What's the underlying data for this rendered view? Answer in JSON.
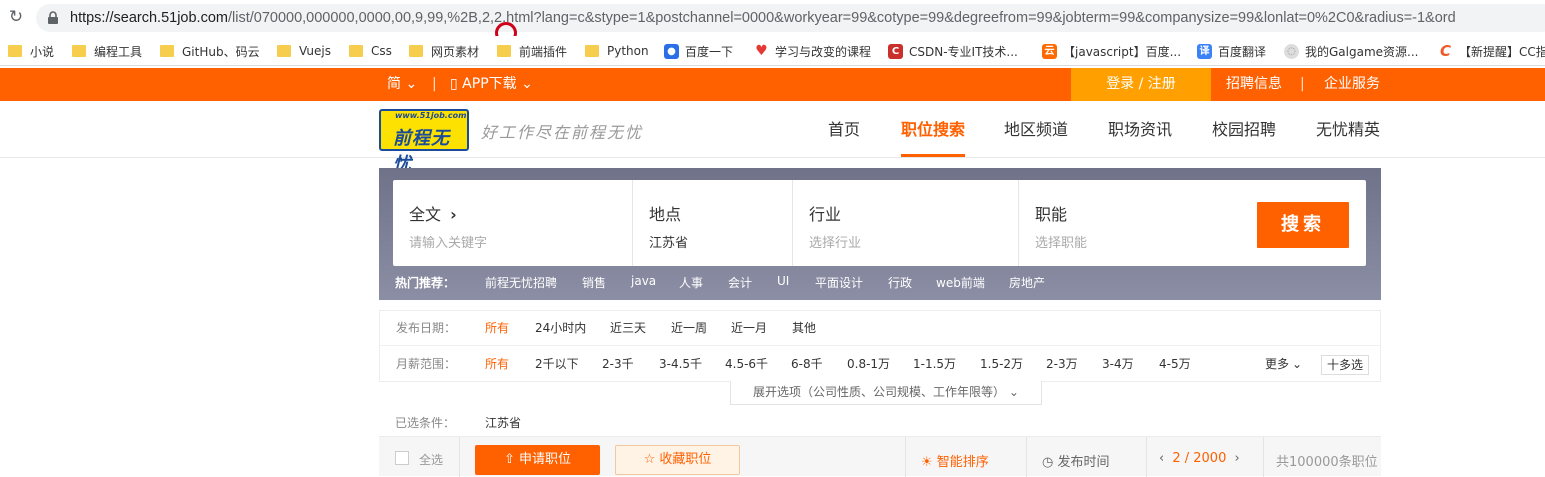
{
  "browser": {
    "url_host": "https://search.51job.com",
    "url_path": "/list/070000,000000,0000,00,9,99,%2B,2,2.html?lang=c&stype=1&postchannel=0000&workyear=99&cotype=99&degreefrom=99&jobterm=99&companysize=99&lonlat=0%2C0&radius=-1&ord",
    "bookmarks": [
      {
        "label": "小说",
        "icon": "folder-icon"
      },
      {
        "label": "编程工具",
        "icon": "folder-icon"
      },
      {
        "label": "GitHub、码云",
        "icon": "folder-icon"
      },
      {
        "label": "Vuejs",
        "icon": "folder-icon"
      },
      {
        "label": "Css",
        "icon": "folder-icon"
      },
      {
        "label": "网页素材",
        "icon": "folder-icon"
      },
      {
        "label": "前端插件",
        "icon": "folder-icon"
      },
      {
        "label": "Python",
        "icon": "folder-icon"
      },
      {
        "label": "百度一下",
        "icon": "baidu-paw-icon"
      },
      {
        "label": "学习与改变的课程",
        "icon": "flame-icon"
      },
      {
        "label": "CSDN-专业IT技术...",
        "icon": "csdn-icon"
      },
      {
        "label": "【javascript】百度...",
        "icon": "cloud-icon"
      },
      {
        "label": "百度翻译",
        "icon": "translate-icon"
      },
      {
        "label": "我的Galgame资源...",
        "icon": "globe-icon"
      },
      {
        "label": "【新提醒】CC指",
        "icon": "c-logo-icon"
      }
    ]
  },
  "topbar": {
    "lang": "简",
    "app": "APP下载",
    "login": "登录 / 注册",
    "recruit": "招聘信息",
    "enterprise": "企业服务"
  },
  "header": {
    "logo_url": "www.51job.com",
    "logo_text": "前程无忧",
    "slogan": "好工作尽在前程无忧",
    "nav": [
      "首页",
      "职位搜索",
      "地区频道",
      "职场资讯",
      "校园招聘",
      "无忧精英"
    ],
    "active_nav": "职位搜索"
  },
  "search": {
    "fulltext_label": "全文",
    "fulltext_placeholder": "请输入关键字",
    "location_label": "地点",
    "location_value": "江苏省",
    "industry_label": "行业",
    "industry_placeholder": "选择行业",
    "function_label": "职能",
    "function_placeholder": "选择职能",
    "button": "搜索",
    "hot_label": "热门推荐：",
    "hot": [
      "前程无忧招聘",
      "销售",
      "java",
      "人事",
      "会计",
      "UI",
      "平面设计",
      "行政",
      "web前端",
      "房地产"
    ]
  },
  "filters": {
    "date_label": "发布日期：",
    "date_options": [
      "所有",
      "24小时内",
      "近三天",
      "近一周",
      "近一月",
      "其他"
    ],
    "salary_label": "月薪范围：",
    "salary_options": [
      "所有",
      "2千以下",
      "2-3千",
      "3-4.5千",
      "4.5-6千",
      "6-8千",
      "0.8-1万",
      "1-1.5万",
      "1.5-2万",
      "2-3万",
      "3-4万",
      "4-5万"
    ],
    "more": "更多",
    "multi": "十多选",
    "expand": "展开选项（公司性质、公司规模、工作年限等）"
  },
  "selected": {
    "label": "已选条件：",
    "value": "江苏省"
  },
  "toolbar": {
    "select_all": "全选",
    "apply": "申请职位",
    "favorite": "收藏职位",
    "smart_sort": "智能排序",
    "publish_time": "发布时间",
    "page": "2 / 2000",
    "total": "共100000条职位"
  }
}
